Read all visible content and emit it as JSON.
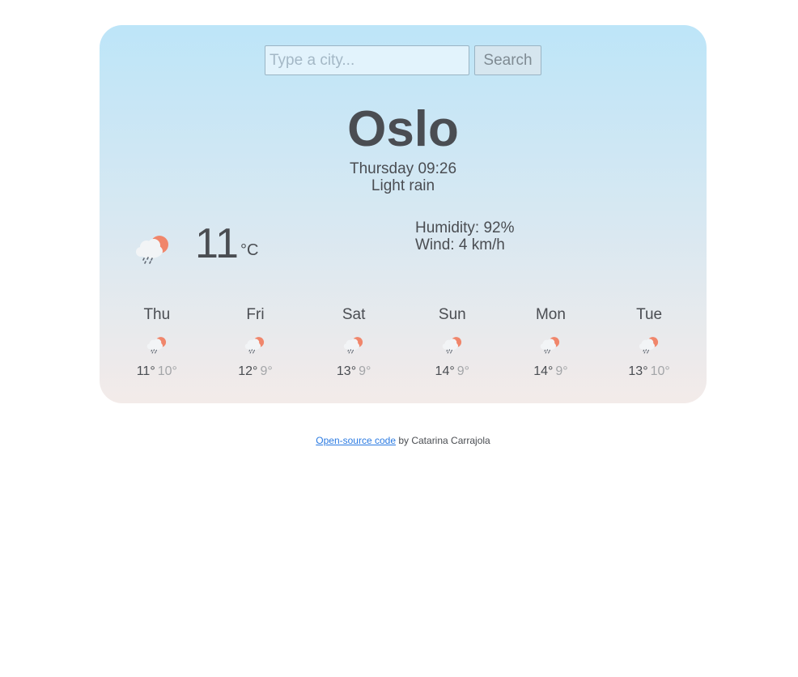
{
  "search": {
    "placeholder": "Type a city...",
    "value": "",
    "button_label": "Search"
  },
  "current": {
    "city": "Oslo",
    "datetime": "Thursday 09:26",
    "condition": "Light rain",
    "temperature": "11",
    "unit": "°C",
    "humidity": "Humidity: 92%",
    "wind": "Wind: 4 km/h",
    "icon": "rain-cloud-sun-icon"
  },
  "forecast": [
    {
      "day": "Thu",
      "high": "11°",
      "low": "10°",
      "icon": "rain-cloud-sun-icon"
    },
    {
      "day": "Fri",
      "high": "12°",
      "low": "9°",
      "icon": "rain-cloud-sun-icon"
    },
    {
      "day": "Sat",
      "high": "13°",
      "low": "9°",
      "icon": "rain-cloud-sun-icon"
    },
    {
      "day": "Sun",
      "high": "14°",
      "low": "9°",
      "icon": "rain-cloud-sun-icon"
    },
    {
      "day": "Mon",
      "high": "14°",
      "low": "9°",
      "icon": "rain-cloud-sun-icon"
    },
    {
      "day": "Tue",
      "high": "13°",
      "low": "10°",
      "icon": "rain-cloud-sun-icon"
    }
  ],
  "footer": {
    "link_text": "Open-source code",
    "suffix": " by Catarina Carrajola"
  },
  "colors": {
    "sun": "#f0866b",
    "cloud": "#f2f4f6",
    "rain": "#636a75",
    "link": "#2a7ae2"
  }
}
